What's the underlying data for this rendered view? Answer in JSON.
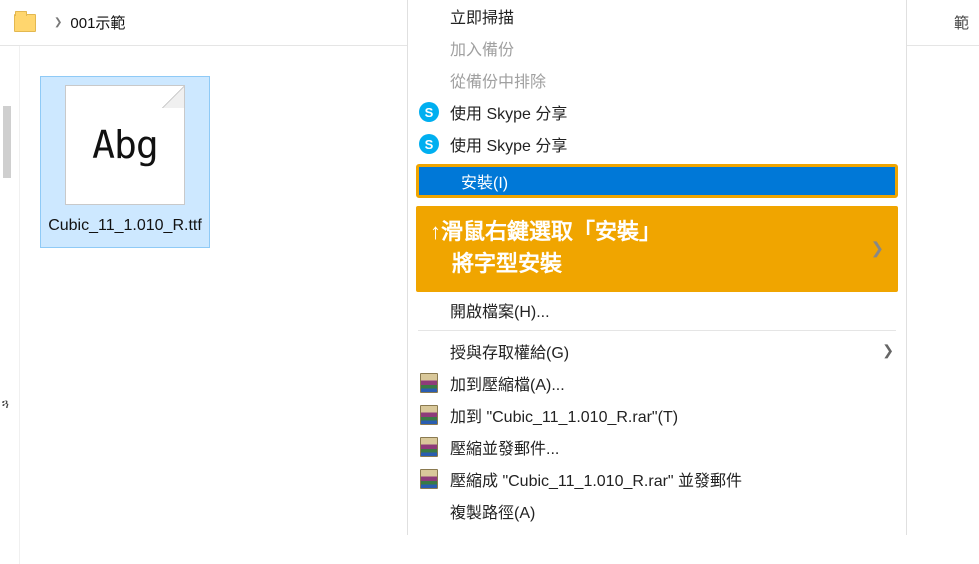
{
  "breadcrumb": {
    "folder_name": "001示範",
    "clipped_right": "範"
  },
  "file": {
    "thumb_sample": "Abg",
    "name": "Cubic_11_1.010_R.ttf"
  },
  "menu": {
    "scan_now": "立即掃描",
    "add_backup": "加入備份",
    "exclude_backup": "從備份中排除",
    "skype_share_1": "使用 Skype 分享",
    "skype_share_2": "使用 Skype 分享",
    "install": "安裝(I)",
    "open_file": "開啟檔案(H)...",
    "grant_access": "授與存取權給(G)",
    "rar_add": "加到壓縮檔(A)...",
    "rar_add_named": "加到 \"Cubic_11_1.010_R.rar\"(T)",
    "rar_compress_mail": "壓縮並發郵件...",
    "rar_compress_named_mail": "壓縮成 \"Cubic_11_1.010_R.rar\" 並發郵件",
    "copy_path": "複製路徑(A)"
  },
  "annotation": {
    "line1": "↑滑鼠右鍵選取「安裝」",
    "line2": "　將字型安裝"
  },
  "icons": {
    "skype_letter": "S"
  }
}
